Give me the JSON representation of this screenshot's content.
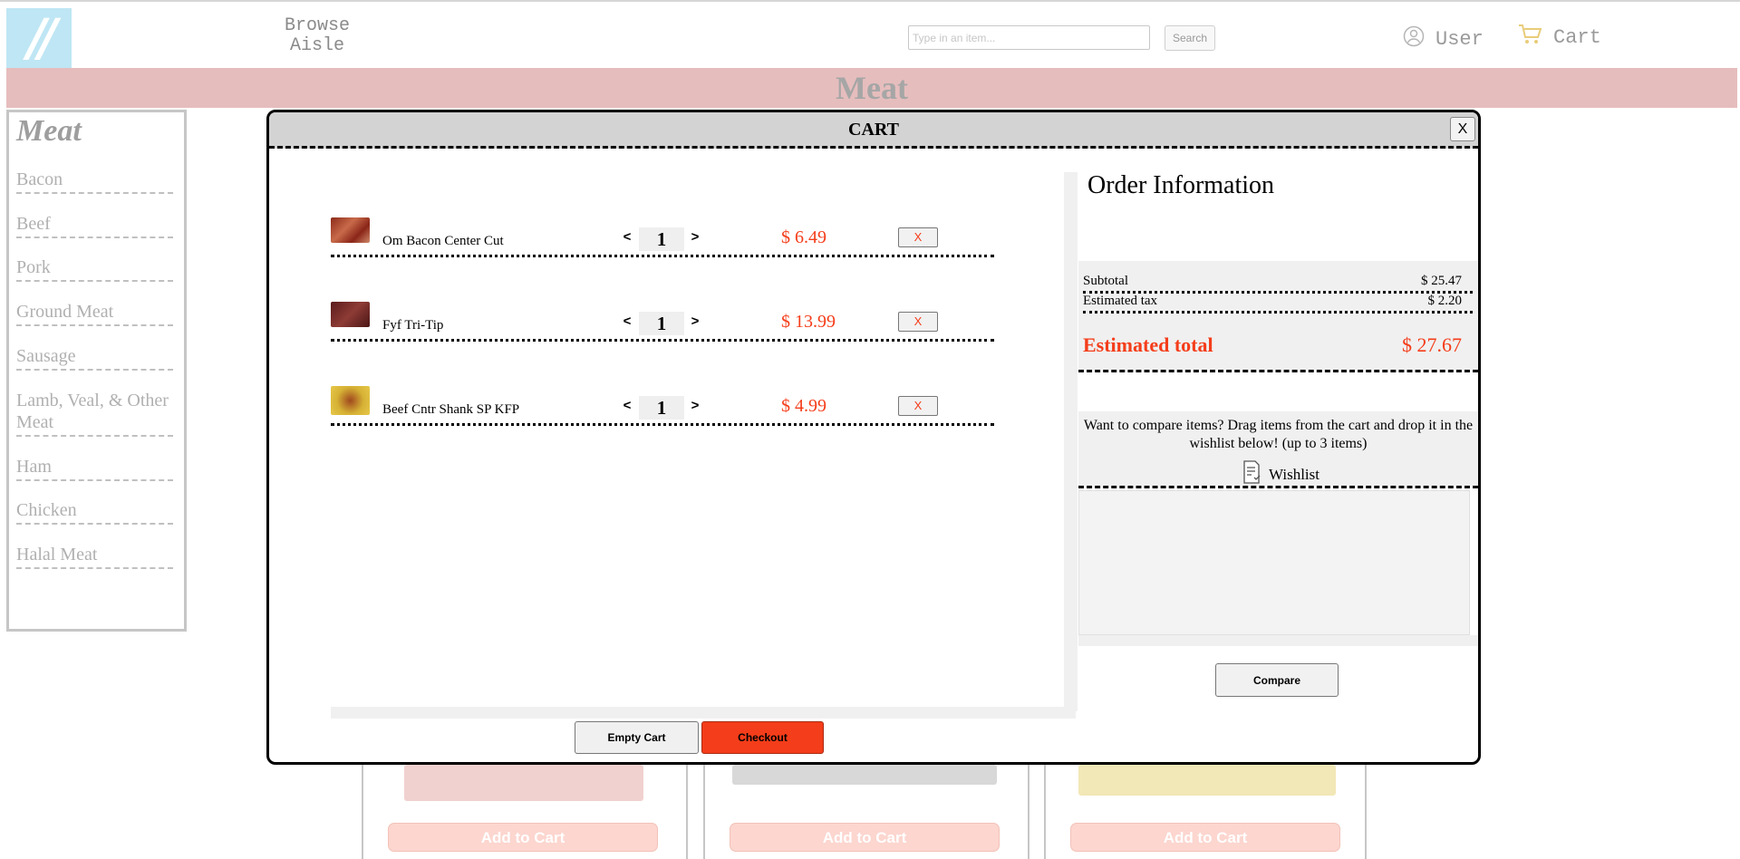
{
  "header": {
    "logo_text": "//",
    "browse_label": "Browse\nAisle",
    "search": {
      "placeholder": "Type in an item...",
      "value": "",
      "button_label": "Search"
    },
    "user_label": "User",
    "cart_label": "Cart"
  },
  "page": {
    "banner_title": "Meat"
  },
  "sidebar": {
    "title": "Meat",
    "items": [
      {
        "label": "Bacon"
      },
      {
        "label": "Beef"
      },
      {
        "label": "Pork"
      },
      {
        "label": "Ground Meat"
      },
      {
        "label": "Sausage"
      },
      {
        "label": "Lamb, Veal, & Other Meat"
      },
      {
        "label": "Ham"
      },
      {
        "label": "Chicken"
      },
      {
        "label": "Halal Meat"
      }
    ]
  },
  "product_cards": [
    {
      "button_label": "Add to Cart"
    },
    {
      "button_label": "Add to Cart"
    },
    {
      "button_label": "Add to Cart"
    }
  ],
  "cart_modal": {
    "title": "CART",
    "close_label": "X",
    "dec_label": "<",
    "inc_label": ">",
    "remove_label": "X",
    "items": [
      {
        "name": "Om Bacon Center Cut",
        "qty": "1",
        "price": "$ 6.49",
        "thumb": "bacon-thumbnail"
      },
      {
        "name": "Fyf Tri-Tip",
        "qty": "1",
        "price": "$ 13.99",
        "thumb": "tri-tip-thumbnail"
      },
      {
        "name": "Beef Cntr Shank SP KFP",
        "qty": "1",
        "price": "$ 4.99",
        "thumb": "beef-shank-thumbnail"
      }
    ],
    "empty_cart_label": "Empty Cart",
    "checkout_label": "Checkout"
  },
  "order_info": {
    "title": "Order Information",
    "subtotal_label": "Subtotal",
    "subtotal_value": "$ 25.47",
    "tax_label": "Estimated tax",
    "tax_value": "$ 2.20",
    "total_label": "Estimated total",
    "total_value": "$ 27.67",
    "compare_hint": "Want to compare items? Drag items from the cart and drop it in the wishlist below! (up to 3 items)",
    "wishlist_label": "Wishlist",
    "compare_button": "Compare"
  },
  "colors": {
    "accent": "#f43d1a",
    "banner": "#e6bdbd",
    "logo_bg": "#bfe6f4"
  }
}
